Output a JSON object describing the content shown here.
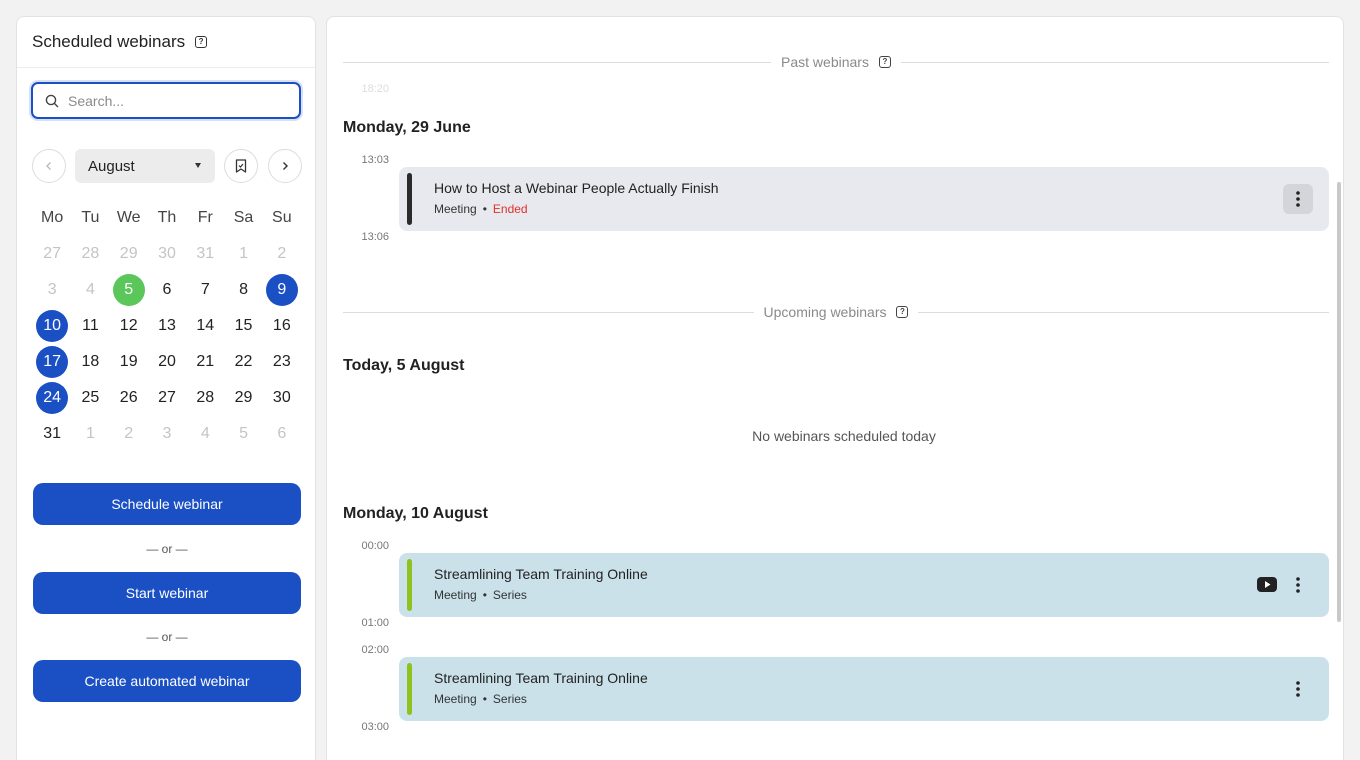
{
  "left": {
    "title": "Scheduled webinars",
    "help_glyph": "?",
    "search": {
      "placeholder": "Search...",
      "value": ""
    },
    "calendar": {
      "month": "August",
      "weekdays": [
        "Mo",
        "Tu",
        "We",
        "Th",
        "Fr",
        "Sa",
        "Su"
      ],
      "weeks": [
        [
          {
            "d": "27",
            "s": "muted"
          },
          {
            "d": "28",
            "s": "muted"
          },
          {
            "d": "29",
            "s": "muted"
          },
          {
            "d": "30",
            "s": "muted"
          },
          {
            "d": "31",
            "s": "muted"
          },
          {
            "d": "1",
            "s": "muted"
          },
          {
            "d": "2",
            "s": "muted"
          }
        ],
        [
          {
            "d": "3",
            "s": "muted"
          },
          {
            "d": "4",
            "s": "muted"
          },
          {
            "d": "5",
            "s": "today"
          },
          {
            "d": "6",
            "s": ""
          },
          {
            "d": "7",
            "s": ""
          },
          {
            "d": "8",
            "s": ""
          },
          {
            "d": "9",
            "s": "sel"
          }
        ],
        [
          {
            "d": "10",
            "s": "sel"
          },
          {
            "d": "11",
            "s": ""
          },
          {
            "d": "12",
            "s": ""
          },
          {
            "d": "13",
            "s": ""
          },
          {
            "d": "14",
            "s": ""
          },
          {
            "d": "15",
            "s": ""
          },
          {
            "d": "16",
            "s": ""
          }
        ],
        [
          {
            "d": "17",
            "s": "sel"
          },
          {
            "d": "18",
            "s": ""
          },
          {
            "d": "19",
            "s": ""
          },
          {
            "d": "20",
            "s": ""
          },
          {
            "d": "21",
            "s": ""
          },
          {
            "d": "22",
            "s": ""
          },
          {
            "d": "23",
            "s": ""
          }
        ],
        [
          {
            "d": "24",
            "s": "sel"
          },
          {
            "d": "25",
            "s": ""
          },
          {
            "d": "26",
            "s": ""
          },
          {
            "d": "27",
            "s": ""
          },
          {
            "d": "28",
            "s": ""
          },
          {
            "d": "29",
            "s": ""
          },
          {
            "d": "30",
            "s": ""
          }
        ],
        [
          {
            "d": "31",
            "s": ""
          },
          {
            "d": "1",
            "s": "muted"
          },
          {
            "d": "2",
            "s": "muted"
          },
          {
            "d": "3",
            "s": "muted"
          },
          {
            "d": "4",
            "s": "muted"
          },
          {
            "d": "5",
            "s": "muted"
          },
          {
            "d": "6",
            "s": "muted"
          }
        ]
      ]
    },
    "buttons": {
      "schedule": "Schedule webinar",
      "or": "— or —",
      "start": "Start webinar",
      "automated": "Create automated webinar"
    }
  },
  "right": {
    "past_label": "Past webinars",
    "upcoming_label": "Upcoming webinars",
    "faded_time": "18:20",
    "past_day": "Monday, 29 June",
    "past_event": {
      "start": "13:03",
      "end": "13:06",
      "title": "How to Host a Webinar People Actually Finish",
      "type": "Meeting",
      "status": "Ended"
    },
    "today_title": "Today, 5 August",
    "empty_message": "No webinars scheduled today",
    "day2_title": "Monday, 10 August",
    "events": [
      {
        "start": "00:00",
        "end": "01:00",
        "title": "Streamlining Team Training Online",
        "type": "Meeting",
        "series": "Series"
      },
      {
        "start": "02:00",
        "end": "03:00",
        "title": "Streamlining Team Training Online",
        "type": "Meeting",
        "series": "Series"
      }
    ],
    "dot": "•"
  },
  "colors": {
    "accent": "#1b4fc4",
    "today": "#5bc65a",
    "ended": "#e0302c",
    "event_bg": "#cbe1ea",
    "past_bg": "#e8e9ee",
    "series_bar": "#8dc21f"
  },
  "icons": [
    "help-icon",
    "search-icon",
    "chevron-left-icon",
    "chevron-right-icon",
    "bookmark-icon",
    "dropdown-caret-icon",
    "kebab-menu-icon",
    "youtube-icon"
  ]
}
